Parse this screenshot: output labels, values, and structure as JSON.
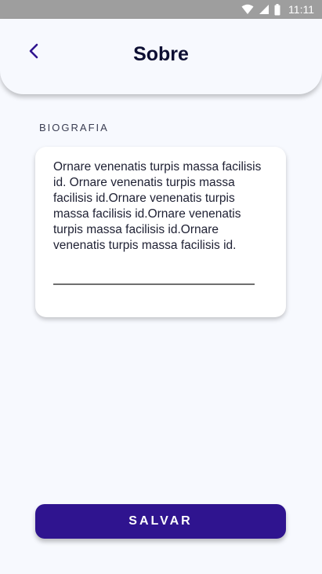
{
  "status_bar": {
    "time": "11:11",
    "icons": [
      "wifi-icon",
      "signal-icon",
      "battery-icon"
    ]
  },
  "header": {
    "title": "Sobre",
    "back_icon": "chevron-left-icon"
  },
  "biography": {
    "label": "BIOGRAFIA",
    "text": "Ornare venenatis turpis massa facilisis id. Ornare venenatis turpis massa facilisis id.Ornare venenatis turpis massa facilisis id.Ornare venenatis turpis massa facilisis id.Ornare venenatis turpis massa facilisis id."
  },
  "actions": {
    "save_label": "SALVAR"
  },
  "colors": {
    "primary": "#2F148F",
    "background": "#F7F9FE",
    "title": "#0D0F33",
    "status_bar": "#9E9E9E"
  }
}
